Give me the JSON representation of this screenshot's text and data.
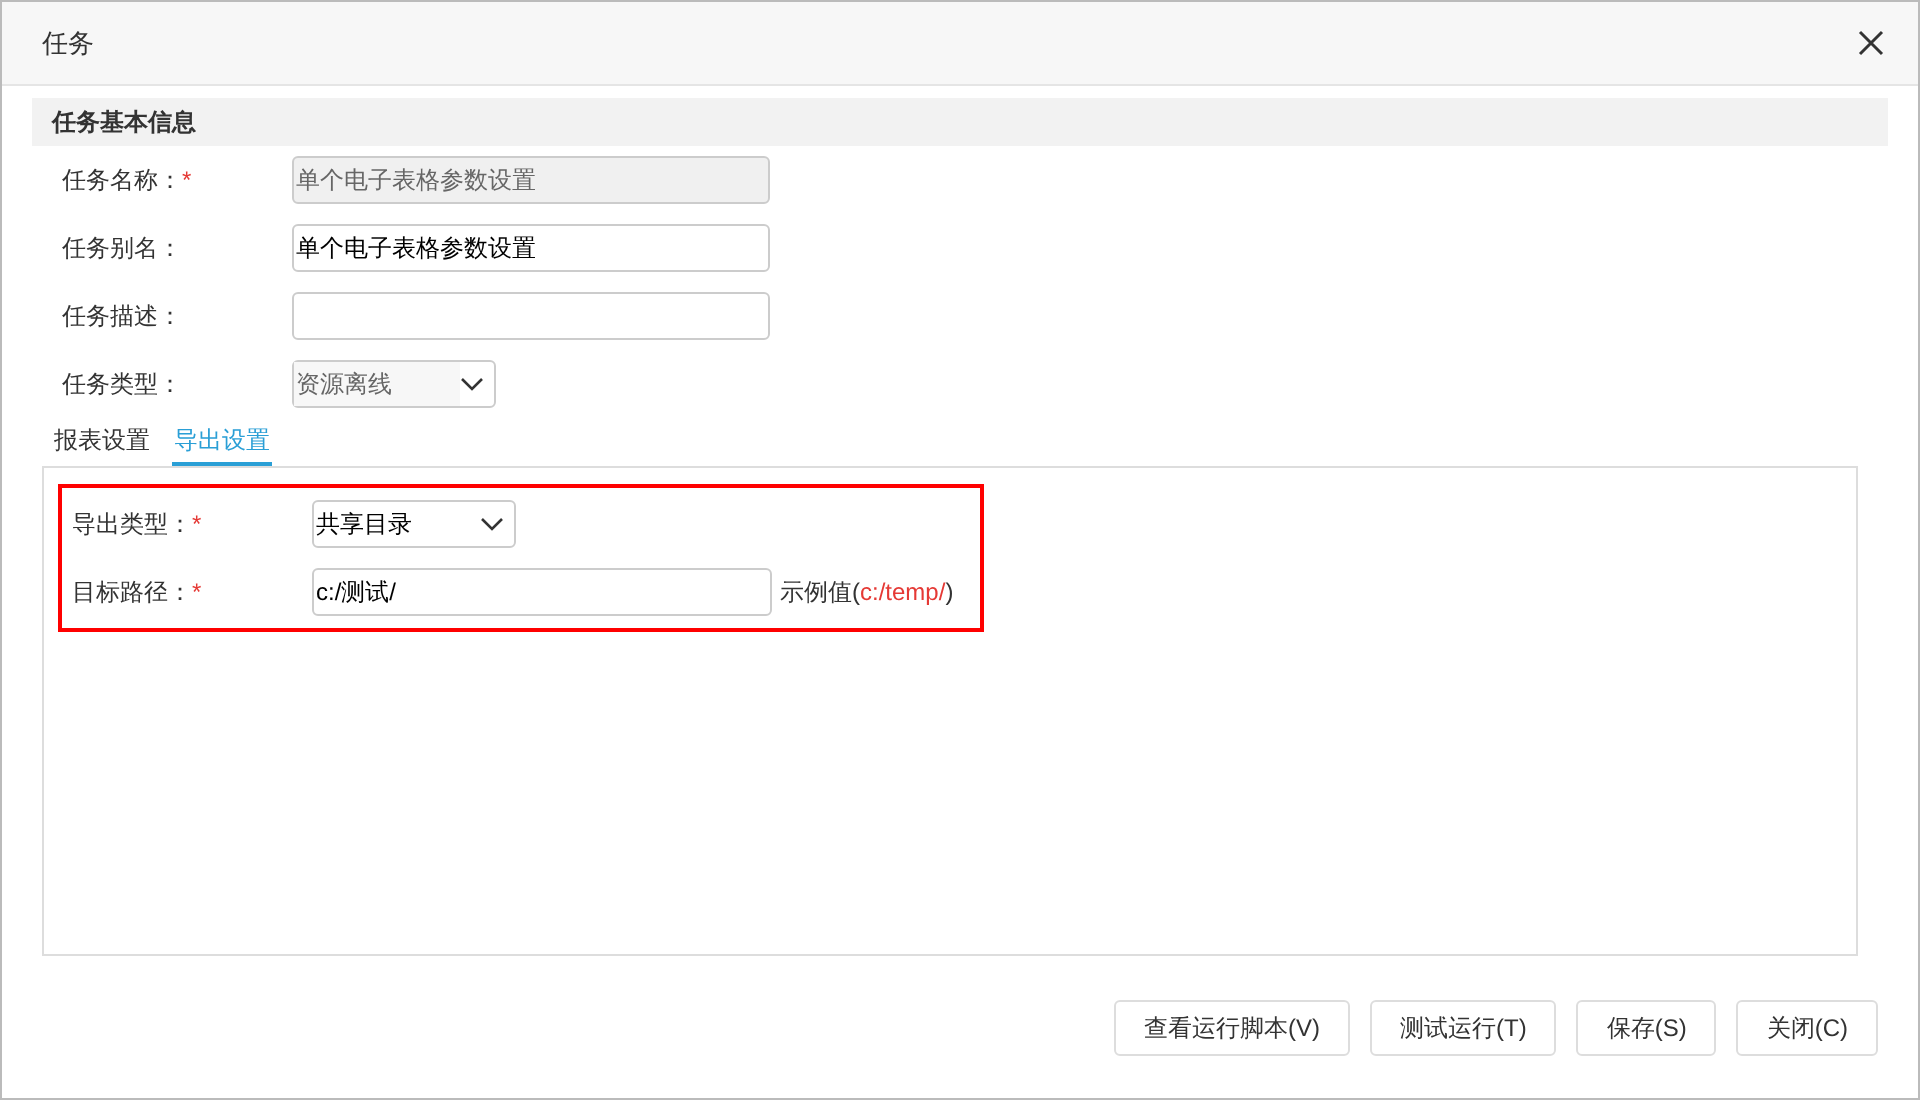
{
  "window": {
    "title": "任务"
  },
  "section": {
    "title": "任务基本信息"
  },
  "fields": [
    {
      "label": "任务名称：",
      "required_mark": "*",
      "kind": "text",
      "value": "单个电子表格参数设置",
      "disabled": true
    },
    {
      "label": "任务别名：",
      "kind": "text",
      "value": "单个电子表格参数设置",
      "disabled": false
    },
    {
      "label": "任务描述：",
      "kind": "text",
      "disabled": false
    },
    {
      "label": "任务类型：",
      "kind": "select",
      "value": "资源离线",
      "disabled": true
    }
  ],
  "tabs": [
    {
      "label": "报表设置",
      "selected": false
    },
    {
      "label": "导出设置",
      "selected": true
    }
  ],
  "export": {
    "highlighted": true,
    "fields": [
      {
        "label": "导出类型：",
        "required_mark": "*",
        "kind": "select",
        "value": "共享目录",
        "disabled": false
      },
      {
        "label": "目标路径：",
        "required_mark": "*",
        "kind": "text",
        "value": "c:/测试/",
        "disabled": false,
        "example": {
          "prefix": "示例值(",
          "value": "c:/temp/",
          "suffix": ")"
        }
      }
    ]
  },
  "buttons": [
    "查看运行脚本(V)",
    "测试运行(T)",
    "保存(S)",
    "关闭(C)"
  ]
}
